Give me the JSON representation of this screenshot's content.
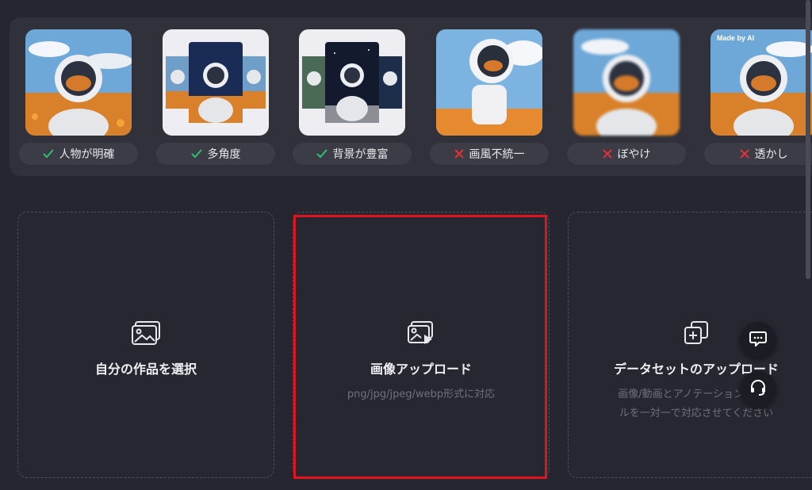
{
  "examples": [
    {
      "label": "人物が明確",
      "status": "ok"
    },
    {
      "label": "多角度",
      "status": "ok"
    },
    {
      "label": "背景が豊富",
      "status": "ok"
    },
    {
      "label": "画風不統一",
      "status": "ng"
    },
    {
      "label": "ぼやけ",
      "status": "ng"
    },
    {
      "label": "透かし",
      "status": "ng",
      "watermark": "Made by AI"
    }
  ],
  "cards": {
    "select": {
      "title": "自分の作品を選択",
      "icon": "gallery-icon"
    },
    "upload": {
      "title": "画像アップロード",
      "desc": "png/jpg/jpeg/webp形式に対応",
      "icon": "image-upload-icon"
    },
    "dataset": {
      "title": "データセットのアップロード",
      "desc": "画像/動画とアノテーションファイルを一対一で対応させてください",
      "icon": "add-copy-icon"
    }
  },
  "colors": {
    "ok": "#2fbf71",
    "ng": "#e2333a",
    "highlight": "#e0141c"
  },
  "float_buttons": [
    "chat-icon",
    "headset-icon"
  ]
}
